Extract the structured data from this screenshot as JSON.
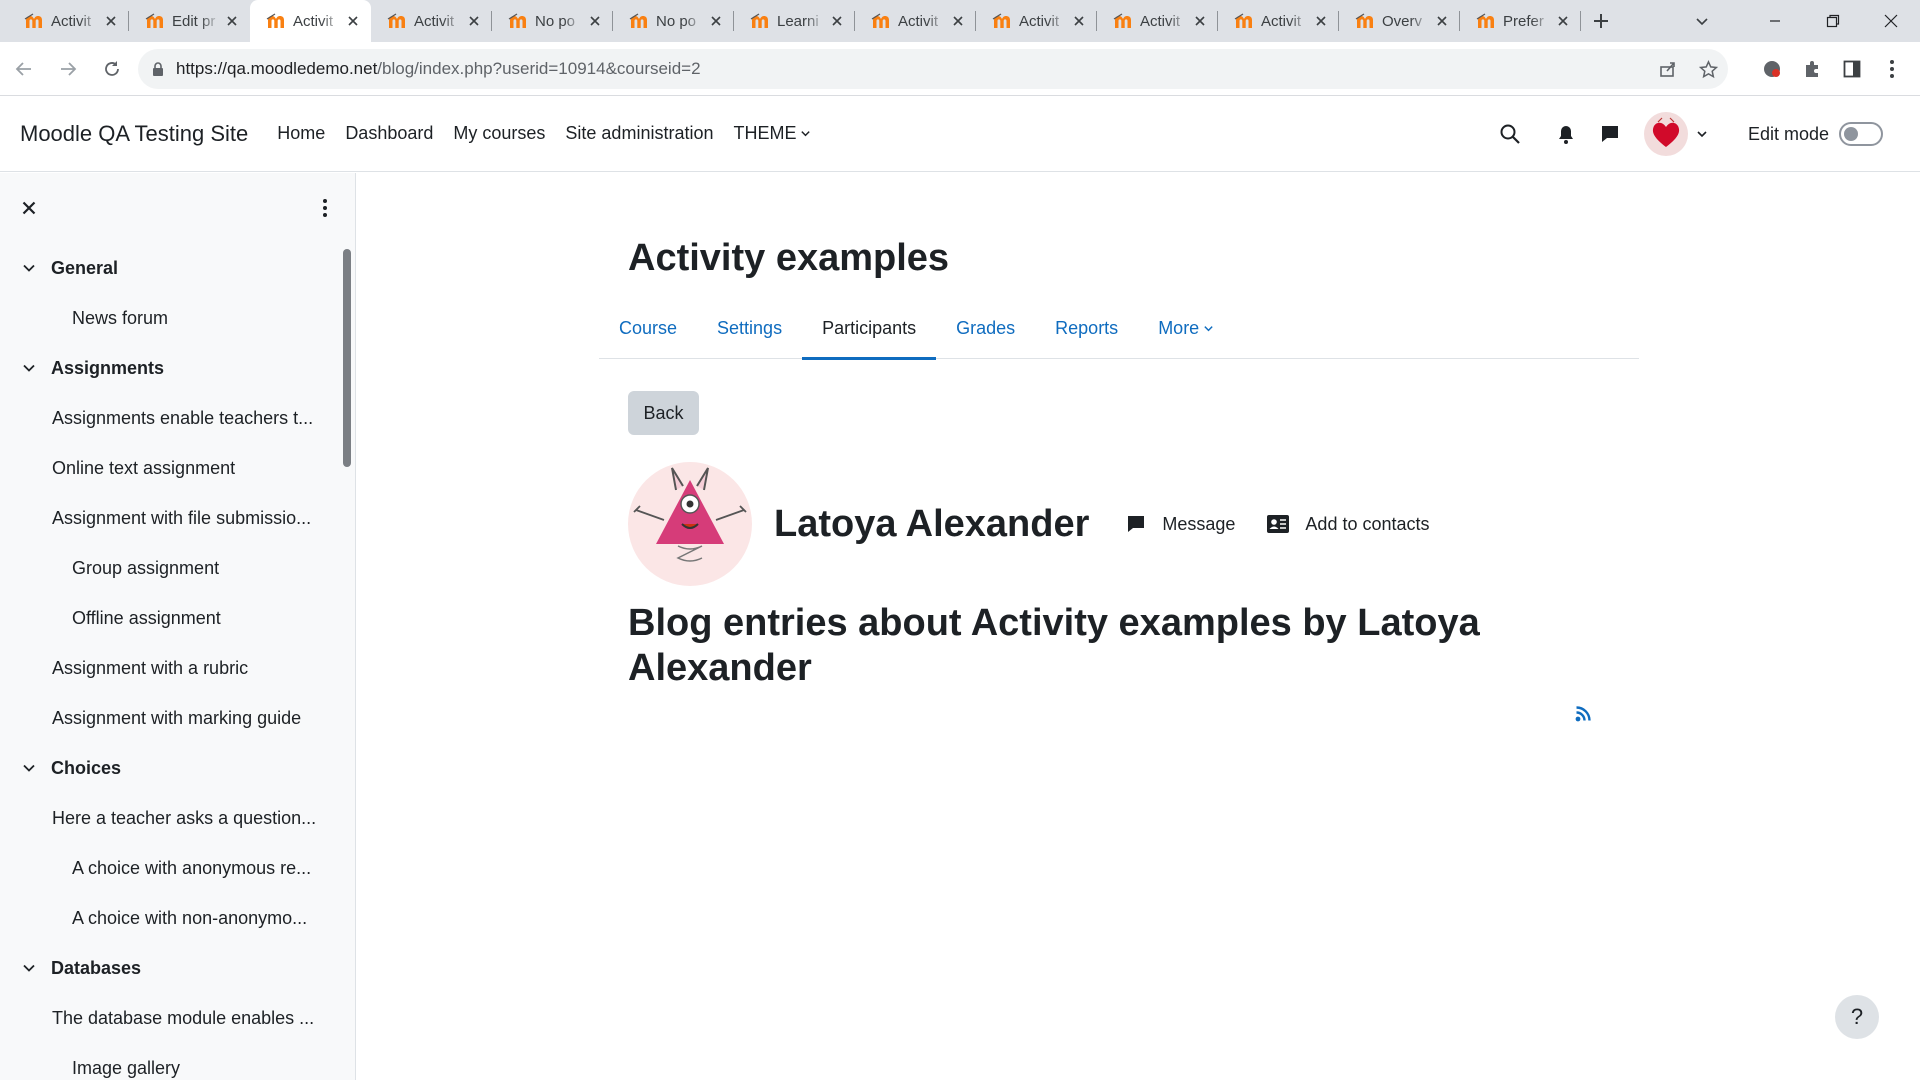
{
  "browser": {
    "tabs": [
      {
        "title": "Activit",
        "active": false
      },
      {
        "title": "Edit pr",
        "active": false
      },
      {
        "title": "Activit",
        "active": true
      },
      {
        "title": "Activit",
        "active": false
      },
      {
        "title": "No po",
        "active": false
      },
      {
        "title": "No po",
        "active": false
      },
      {
        "title": "Learni",
        "active": false
      },
      {
        "title": "Activit",
        "active": false
      },
      {
        "title": "Activit",
        "active": false
      },
      {
        "title": "Activit",
        "active": false
      },
      {
        "title": "Activit",
        "active": false
      },
      {
        "title": "Overv",
        "active": false
      },
      {
        "title": "Prefer",
        "active": false
      }
    ],
    "url_host": "https://qa.moodledemo.net",
    "url_path": "/blog/index.php?userid=10914&courseid=2"
  },
  "navbar": {
    "site_name": "Moodle QA Testing Site",
    "items": [
      {
        "label": "Home"
      },
      {
        "label": "Dashboard"
      },
      {
        "label": "My courses"
      },
      {
        "label": "Site administration"
      },
      {
        "label": "THEME",
        "dropdown": true
      }
    ],
    "edit_mode_label": "Edit mode",
    "edit_mode_on": false
  },
  "course_index": {
    "entries": [
      {
        "type": "section",
        "label": "General"
      },
      {
        "type": "item",
        "label": "News forum",
        "indent": true
      },
      {
        "type": "section",
        "label": "Assignments"
      },
      {
        "type": "item",
        "label": "Assignments enable teachers t...",
        "indent": false
      },
      {
        "type": "item",
        "label": "Online text assignment",
        "indent": false
      },
      {
        "type": "item",
        "label": "Assignment with file submissio...",
        "indent": false
      },
      {
        "type": "item",
        "label": "Group assignment",
        "indent": true
      },
      {
        "type": "item",
        "label": "Offline assignment",
        "indent": true
      },
      {
        "type": "item",
        "label": "Assignment with a rubric",
        "indent": false
      },
      {
        "type": "item",
        "label": "Assignment with marking guide",
        "indent": false
      },
      {
        "type": "section",
        "label": "Choices"
      },
      {
        "type": "item",
        "label": "Here a teacher asks a question...",
        "indent": false
      },
      {
        "type": "item",
        "label": "A choice with anonymous re...",
        "indent": true
      },
      {
        "type": "item",
        "label": "A choice with non-anonymo...",
        "indent": true
      },
      {
        "type": "section",
        "label": "Databases"
      },
      {
        "type": "item",
        "label": "The database module enables ...",
        "indent": false
      },
      {
        "type": "item",
        "label": "Image gallery",
        "indent": true
      }
    ]
  },
  "course": {
    "title": "Activity examples",
    "tabs": [
      {
        "label": "Course",
        "active": false
      },
      {
        "label": "Settings",
        "active": false
      },
      {
        "label": "Participants",
        "active": true
      },
      {
        "label": "Grades",
        "active": false
      },
      {
        "label": "Reports",
        "active": false
      },
      {
        "label": "More",
        "active": false,
        "dropdown": true
      }
    ]
  },
  "page": {
    "back_label": "Back",
    "user_name": "Latoya Alexander",
    "message_label": "Message",
    "add_contact_label": "Add to contacts",
    "blog_heading": "Blog entries about Activity examples by Latoya Alexander",
    "help_label": "?"
  },
  "colors": {
    "link": "#0f6cbf",
    "text": "#1d2125",
    "drawer_bg": "#f8f9fa",
    "button_secondary": "#ced4da",
    "moodle_orange": "#f98012"
  }
}
